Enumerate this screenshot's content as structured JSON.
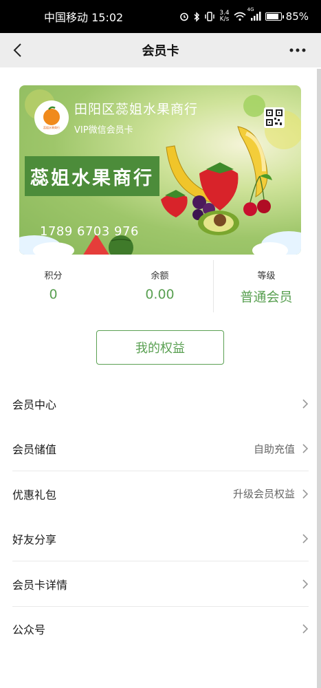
{
  "status_bar": {
    "carrier_time": "中国移动 15:02",
    "net_speed_value": "3.4",
    "net_speed_unit": "K/s",
    "network_tag": "4G",
    "battery_percent": "85%",
    "battery_level": 0.85
  },
  "nav": {
    "title": "会员卡",
    "back_icon": "chevron-left-icon",
    "more_icon": "more-dots-icon"
  },
  "card": {
    "title": "田阳区蕊姐水果商行",
    "subtitle": "VIP微信会员卡",
    "banner_text": "蕊姐水果商行",
    "number": "1789 6703 976",
    "logo_text": "蕊姐水果商行",
    "qr_icon": "qr-code-icon"
  },
  "stats": [
    {
      "label": "积分",
      "value": "0"
    },
    {
      "label": "余额",
      "value": "0.00"
    },
    {
      "label": "等级",
      "value": "普通会员"
    }
  ],
  "benefits_button": "我的权益",
  "menu": [
    {
      "label": "会员中心",
      "value": ""
    },
    {
      "label": "会员储值",
      "value": "自助充值"
    },
    {
      "label": "优惠礼包",
      "value": "升级会员权益"
    },
    {
      "label": "好友分享",
      "value": ""
    },
    {
      "label": "会员卡详情",
      "value": ""
    },
    {
      "label": "公众号",
      "value": ""
    }
  ],
  "colors": {
    "accent": "#5aa052",
    "nav_bg": "#ededed",
    "banner": "#4c8c3a"
  }
}
